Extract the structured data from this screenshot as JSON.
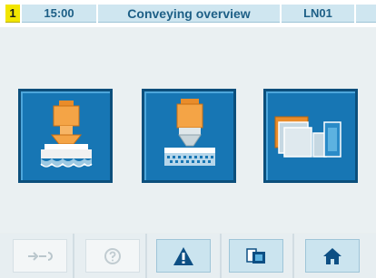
{
  "header": {
    "screen_number": "1",
    "time": "15:00",
    "title": "Conveying overview",
    "line_id": "LN01"
  },
  "main": {
    "tiles": [
      {
        "icon": "press-hydraulic-icon",
        "label": ""
      },
      {
        "icon": "press-tooling-icon",
        "label": ""
      },
      {
        "icon": "conveyor-transfer-icon",
        "label": ""
      }
    ]
  },
  "toolbar": {
    "buttons": [
      {
        "icon": "wrench-icon",
        "enabled": false
      },
      {
        "icon": "help-icon",
        "enabled": false
      },
      {
        "icon": "warning-icon",
        "enabled": true
      },
      {
        "icon": "screen-switch-icon",
        "enabled": true
      },
      {
        "icon": "home-icon",
        "enabled": true
      }
    ]
  },
  "colors": {
    "tile_blue": "#1776b4",
    "header_text": "#1d5f86",
    "screen_number_bg": "#f2e500",
    "accent_orange": "#f2a33a"
  }
}
